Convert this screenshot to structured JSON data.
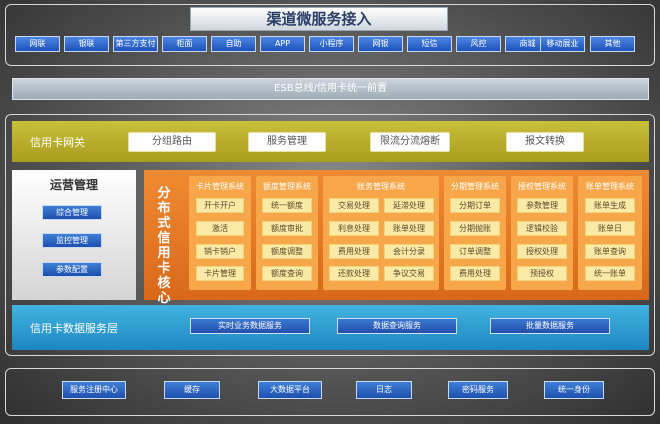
{
  "access": {
    "title": "渠道微服务接入",
    "channels": [
      "网联",
      "银联",
      "第三方支付",
      "柜面",
      "自助",
      "APP",
      "小程序",
      "网银",
      "短信",
      "风控",
      "商城",
      "移动展业",
      "其他"
    ]
  },
  "esb": {
    "label": "ESB总线/信用卡统一前置"
  },
  "gateway": {
    "title": "信用卡网关",
    "items": [
      "分组路由",
      "服务管理",
      "限流分流熔断",
      "报文转换"
    ]
  },
  "ops": {
    "title": "运营管理",
    "items": [
      "综合管理",
      "监控管理",
      "参数配置"
    ]
  },
  "core": {
    "title": "分布式信用卡核心",
    "modules": [
      {
        "title": "卡片管理系统",
        "items": [
          "开卡开户",
          "激活",
          "销卡销户",
          "卡片管理"
        ]
      },
      {
        "title": "额度管理系统",
        "items": [
          "统一额度",
          "额度审批",
          "额度调整",
          "额度查询"
        ]
      },
      {
        "title": "账务管理系统",
        "items": [
          "交易处理",
          "延滞处理",
          "利息处理",
          "账单处理",
          "费用处理",
          "会计分录",
          "还款处理",
          "争议交易"
        ]
      },
      {
        "title": "分期管理系统",
        "items": [
          "分期订单",
          "分期抛账",
          "订单调整",
          "费用处理"
        ]
      },
      {
        "title": "授权管理系统",
        "items": [
          "参数管理",
          "逻辑校验",
          "授权处理",
          "预授权"
        ]
      },
      {
        "title": "账单管理系统",
        "items": [
          "账单生成",
          "账单日",
          "账单查询",
          "统一账单"
        ]
      }
    ]
  },
  "data_service": {
    "title": "信用卡数据服务层",
    "items": [
      "实时业务数据服务",
      "数据查询服务",
      "批量数据服务"
    ]
  },
  "infra": {
    "items": [
      "服务注册中心",
      "缓存",
      "大数据平台",
      "日志",
      "密码服务",
      "统一身份"
    ]
  }
}
